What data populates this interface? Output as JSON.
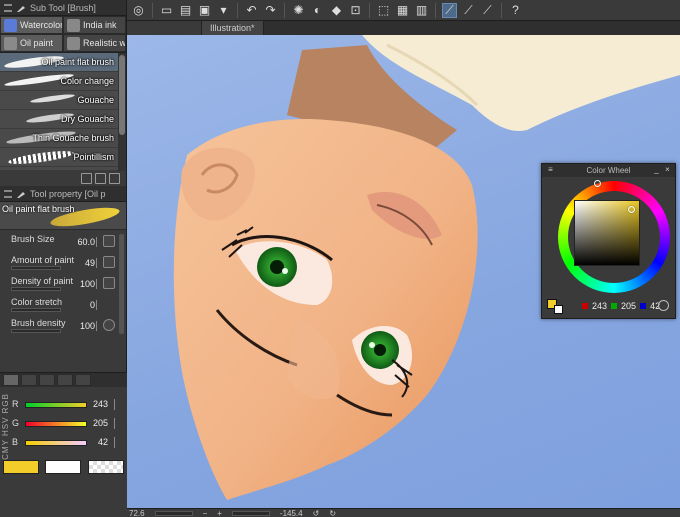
{
  "subtool": {
    "panel_title": "Sub Tool [Brush]",
    "groups": [
      "Watercolor",
      "India ink",
      "Oil paint",
      "Realistic w"
    ],
    "brushes": [
      "Oil paint flat brush",
      "Color change",
      "Gouache",
      "Dry Gouache",
      "Thin Gouache brush",
      "Pointillism"
    ]
  },
  "tool_property": {
    "panel_title": "Tool property [Oil p",
    "preview_name": "Oil paint flat brush",
    "props": [
      {
        "label": "Brush Size",
        "value": "60.0"
      },
      {
        "label": "Amount of paint",
        "value": "49"
      },
      {
        "label": "Density of paint",
        "value": "100"
      },
      {
        "label": "Color stretch",
        "value": "0"
      },
      {
        "label": "Brush density",
        "value": "100"
      }
    ]
  },
  "color_sliders": {
    "modes": "CMY HSV RGB",
    "channels": [
      {
        "label": "R",
        "value": "243"
      },
      {
        "label": "G",
        "value": "205"
      },
      {
        "label": "B",
        "value": "42"
      }
    ]
  },
  "doc_tabs": [
    "Illustration*"
  ],
  "color_wheel": {
    "title": "Color Wheel",
    "r": "243",
    "g": "205",
    "b": "42"
  },
  "status": {
    "zoom": "72.6",
    "rotation": "-145.4"
  },
  "colors": {
    "main": "#f3cd2a",
    "sub": "#ffffff"
  }
}
